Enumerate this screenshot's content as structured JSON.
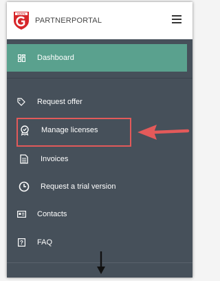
{
  "header": {
    "brand": "PARTNERPORTAL",
    "logo_text": "GDATA",
    "logo_icon": "gdata-shield-logo",
    "menu_icon": "hamburger-icon"
  },
  "nav": {
    "items": [
      {
        "label": "Dashboard",
        "icon": "dashboard-icon",
        "active": true
      },
      {
        "label": "Request offer",
        "icon": "tag-icon"
      },
      {
        "label": "Manage licenses",
        "icon": "award-badge-icon",
        "highlighted": true
      },
      {
        "label": "Invoices",
        "icon": "document-icon"
      },
      {
        "label": "Request a trial version",
        "icon": "clock-icon"
      },
      {
        "label": "Contacts",
        "icon": "contact-card-icon"
      },
      {
        "label": "FAQ",
        "icon": "question-icon"
      }
    ]
  },
  "colors": {
    "sidebar_bg": "#46505a",
    "active_bg": "#5aa18e",
    "highlight": "#e35a5a"
  }
}
